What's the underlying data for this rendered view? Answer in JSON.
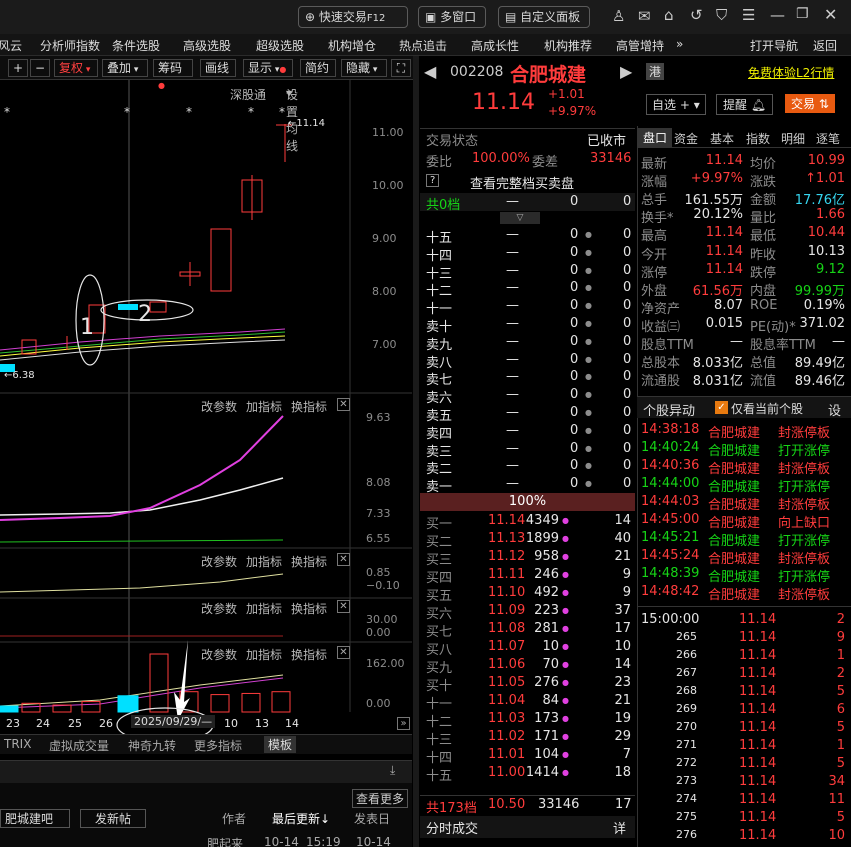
{
  "topbar": {
    "quick_trade": "快速交易",
    "quick_trade_key": "F12",
    "multi_window": "多窗口",
    "custom_panel": "自定义面板"
  },
  "menu": [
    "风云",
    "分析师指数",
    "条件选股",
    "高级选股",
    "超级选股",
    "机构增仓",
    "热点追击",
    "高成长性",
    "机构推荐",
    "高管增持",
    "»",
    "打开导航",
    "返回"
  ],
  "toolbar": {
    "plus": "+",
    "minus": "−",
    "fuquan": "复权",
    "diejia": "叠加",
    "chouma": "筹码",
    "huaxian": "画线",
    "xianshi": "显示",
    "jianyue": "简约",
    "yincang": "隐藏",
    "expand": "⛶"
  },
  "kline": {
    "shenzhen": "深股通",
    "set_ma": "设置均线",
    "price_labels": [
      "11.00",
      "10.00",
      "9.00",
      "8.00",
      "7.00"
    ],
    "high_label": "←11.14",
    "low_label": "←6.38",
    "anno1": "1",
    "anno2": "2",
    "dates": [
      "23",
      "24",
      "25",
      "26",
      "13",
      "14"
    ],
    "date_pill": "2025/09/29/—",
    "bars": [
      0.1,
      0.15,
      0.12,
      0.18,
      0.28,
      1.0,
      0.35,
      0.3,
      0.32,
      0.35,
      0.4,
      0.4,
      0.6
    ]
  },
  "sub": {
    "change_param": "改参数",
    "add_indicator": "加指标",
    "switch_indicator": "换指标",
    "ind1_labels": [
      "9.63",
      "8.08",
      "7.33",
      "6.55"
    ],
    "ind2_labels": [
      "0.85",
      "−0.10"
    ],
    "ind3_labels": [
      "30.00",
      "0.00"
    ],
    "ind4_labels": [
      "162.00",
      "0.00"
    ]
  },
  "bottom_tabs": [
    "TRIX",
    "虚拟成交量",
    "神奇九转",
    "更多指标",
    "模板"
  ],
  "forum": {
    "check_more": "查看更多",
    "bar_name": "肥城建吧",
    "post": "发新帖",
    "author": "作者",
    "last_update": "最后更新↓",
    "publish": "发表日",
    "row_title": "肥起来",
    "row_date": "10-14",
    "row_time": "15:19",
    "row_date2": "10-14"
  },
  "stock": {
    "code": "002208",
    "name": "合肥城建",
    "hk_badge": "港",
    "free_l2": "免费体验L2行情",
    "price": "11.14",
    "change": "+1.01",
    "pct": "+9.97%",
    "zixuan": "自选",
    "alert": "提醒",
    "trade": "交易"
  },
  "book": {
    "state_label": "交易状态",
    "state": "已收市",
    "ratio_label": "委比",
    "ratio": "100.00%",
    "diff_label": "委差",
    "diff": "33146",
    "full_book": "查看完整档买卖盘",
    "total_label": "共0档",
    "total_vals": [
      "—",
      "0",
      "0"
    ],
    "sells": [
      "十五",
      "十四",
      "十三",
      "十二",
      "十一",
      "卖十",
      "卖九",
      "卖八",
      "卖七",
      "卖六",
      "卖五",
      "卖四",
      "卖三",
      "卖二",
      "卖一"
    ],
    "dash": "—",
    "zero": "0",
    "pct_bar": "100%",
    "buys": [
      [
        "买一",
        "11.14",
        "4349",
        "14"
      ],
      [
        "买二",
        "11.13",
        "1899",
        "40"
      ],
      [
        "买三",
        "11.12",
        "958",
        "21"
      ],
      [
        "买四",
        "11.11",
        "246",
        "9"
      ],
      [
        "买五",
        "11.10",
        "492",
        "9"
      ],
      [
        "买六",
        "11.09",
        "223",
        "37"
      ],
      [
        "买七",
        "11.08",
        "281",
        "17"
      ],
      [
        "买八",
        "11.07",
        "10",
        "10"
      ],
      [
        "买九",
        "11.06",
        "70",
        "14"
      ],
      [
        "买十",
        "11.05",
        "276",
        "23"
      ],
      [
        "十一",
        "11.04",
        "84",
        "21"
      ],
      [
        "十二",
        "11.03",
        "173",
        "19"
      ],
      [
        "十三",
        "11.02",
        "171",
        "29"
      ],
      [
        "十四",
        "11.01",
        "104",
        "7"
      ],
      [
        "十五",
        "11.00",
        "1414",
        "18"
      ]
    ],
    "footer": [
      "共173档",
      "10.50",
      "33146",
      "17"
    ],
    "timesales": "分时成交",
    "detail": "详"
  },
  "tabs": [
    "盘口",
    "资金",
    "基本",
    "指数",
    "明细",
    "逐笔"
  ],
  "quote": [
    [
      "最新",
      "11.14",
      "均价",
      "10.99"
    ],
    [
      "涨幅",
      "+9.97%",
      "涨跌",
      "↑1.01"
    ],
    [
      "总手",
      "161.55万",
      "金额",
      "17.76亿"
    ],
    [
      "换手*",
      "20.12%",
      "量比",
      "1.66"
    ],
    [
      "最高",
      "11.14",
      "最低",
      "10.44"
    ],
    [
      "今开",
      "11.14",
      "昨收",
      "10.13"
    ],
    [
      "涨停",
      "11.14",
      "跌停",
      "9.12"
    ],
    [
      "外盘",
      "61.56万",
      "内盘",
      "99.99万"
    ],
    [
      "净资产",
      "8.07",
      "ROE",
      "0.19%"
    ],
    [
      "收益㈢",
      "0.015",
      "PE(动)*",
      "371.02"
    ],
    [
      "股息TTM",
      "—",
      "股息率TTM",
      "—"
    ],
    [
      "总股本",
      "8.033亿",
      "总值",
      "89.49亿"
    ],
    [
      "流通股",
      "8.031亿",
      "流值",
      "89.46亿"
    ]
  ],
  "alerts": {
    "title": "个股异动",
    "only_current": "仅看当前个股",
    "settings": "设",
    "rows": [
      [
        "14:38:18",
        "合肥城建",
        "封涨停板",
        "r"
      ],
      [
        "14:40:24",
        "合肥城建",
        "打开涨停",
        "g"
      ],
      [
        "14:40:36",
        "合肥城建",
        "封涨停板",
        "r"
      ],
      [
        "14:44:00",
        "合肥城建",
        "打开涨停",
        "g"
      ],
      [
        "14:44:03",
        "合肥城建",
        "封涨停板",
        "r"
      ],
      [
        "14:45:00",
        "合肥城建",
        "向上缺口",
        "r"
      ],
      [
        "14:45:21",
        "合肥城建",
        "打开涨停",
        "g"
      ],
      [
        "14:45:24",
        "合肥城建",
        "封涨停板",
        "r"
      ],
      [
        "14:48:39",
        "合肥城建",
        "打开涨停",
        "g"
      ],
      [
        "14:48:42",
        "合肥城建",
        "封涨停板",
        "r"
      ]
    ]
  },
  "ticks": [
    [
      "15:00:00",
      "11.14",
      "2"
    ],
    [
      "265",
      "11.14",
      "9"
    ],
    [
      "266",
      "11.14",
      "1"
    ],
    [
      "267",
      "11.14",
      "2"
    ],
    [
      "268",
      "11.14",
      "5"
    ],
    [
      "269",
      "11.14",
      "6"
    ],
    [
      "270",
      "11.14",
      "5"
    ],
    [
      "271",
      "11.14",
      "1"
    ],
    [
      "272",
      "11.14",
      "5"
    ],
    [
      "273",
      "11.14",
      "34"
    ],
    [
      "274",
      "11.14",
      "11"
    ],
    [
      "275",
      "11.14",
      "5"
    ],
    [
      "276",
      "11.14",
      "10"
    ]
  ]
}
